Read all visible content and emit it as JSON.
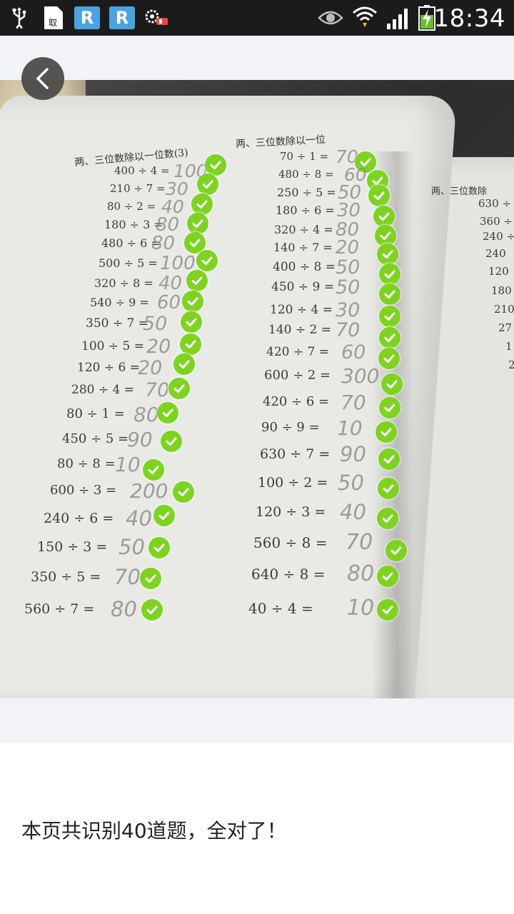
{
  "status_bar": {
    "time": "18:34",
    "icons": [
      "usb-icon",
      "document-icon",
      "r-app-icon",
      "r-app-icon",
      "gear-app-icon",
      "eye-icon",
      "wifi-icon",
      "signal-icon",
      "battery-charging-icon"
    ]
  },
  "back_button": {
    "icon": "chevron-left-icon"
  },
  "photo": {
    "left_heading": "两、三位数除以一位数(3)",
    "right_heading": "两、三位数除以一位",
    "far_right_heading": "两、三位数除",
    "column1": [
      {
        "q": "400 ÷ 4 =",
        "a": "100"
      },
      {
        "q": "210 ÷ 7 =",
        "a": "30"
      },
      {
        "q": "80 ÷ 2 =",
        "a": "40"
      },
      {
        "q": "180 ÷ 3 =",
        "a": "80"
      },
      {
        "q": "480 ÷ 6 =",
        "a": "80"
      },
      {
        "q": "500 ÷ 5 =",
        "a": "100"
      },
      {
        "q": "320 ÷ 8 =",
        "a": "40"
      },
      {
        "q": "540 ÷ 9 =",
        "a": "60"
      },
      {
        "q": "350 ÷ 7 =",
        "a": "50"
      },
      {
        "q": "100 ÷ 5 =",
        "a": "20"
      },
      {
        "q": "120 ÷ 6 =",
        "a": "20"
      },
      {
        "q": "280 ÷ 4 =",
        "a": "70"
      },
      {
        "q": "80 ÷ 1 =",
        "a": "80"
      },
      {
        "q": "450 ÷ 5 =",
        "a": "90"
      },
      {
        "q": "80 ÷ 8 =",
        "a": "10"
      },
      {
        "q": "600 ÷ 3 =",
        "a": "200"
      },
      {
        "q": "240 ÷ 6 =",
        "a": "40"
      },
      {
        "q": "150 ÷ 3 =",
        "a": "50"
      },
      {
        "q": "350 ÷ 5 =",
        "a": "70"
      },
      {
        "q": "560 ÷ 7 =",
        "a": "80"
      }
    ],
    "column2": [
      {
        "q": "70 ÷ 1 =",
        "a": "70"
      },
      {
        "q": "480 ÷ 8 =",
        "a": "60"
      },
      {
        "q": "250 ÷ 5 =",
        "a": "50"
      },
      {
        "q": "180 ÷ 6 =",
        "a": "30"
      },
      {
        "q": "320 ÷ 4 =",
        "a": "80"
      },
      {
        "q": "140 ÷ 7 =",
        "a": "20"
      },
      {
        "q": "400 ÷ 8 =",
        "a": "50"
      },
      {
        "q": "450 ÷ 9 =",
        "a": "50"
      },
      {
        "q": "120 ÷ 4 =",
        "a": "30"
      },
      {
        "q": "140 ÷ 2 =",
        "a": "70"
      },
      {
        "q": "420 ÷ 7 =",
        "a": "60"
      },
      {
        "q": "600 ÷ 2 =",
        "a": "300"
      },
      {
        "q": "420 ÷ 6 =",
        "a": "70"
      },
      {
        "q": "90 ÷ 9 =",
        "a": "10"
      },
      {
        "q": "630 ÷ 7 =",
        "a": "90"
      },
      {
        "q": "100 ÷ 2 =",
        "a": "50"
      },
      {
        "q": "120 ÷ 3 =",
        "a": "40"
      },
      {
        "q": "560 ÷ 8 =",
        "a": "70"
      },
      {
        "q": "640 ÷ 8 =",
        "a": "80"
      },
      {
        "q": "40 ÷ 4 =",
        "a": "10"
      }
    ],
    "right_page_items": [
      "630 ÷",
      "360 ÷",
      "240 ÷",
      "240",
      "120",
      "180",
      "210",
      "27",
      "1",
      "2"
    ]
  },
  "result": {
    "message": "本页共识别40道题，全对了！"
  },
  "colors": {
    "check_green": "#7ed321",
    "status_bar_bg": "#1b1b1b",
    "page_bg": "#f1f3f6"
  }
}
